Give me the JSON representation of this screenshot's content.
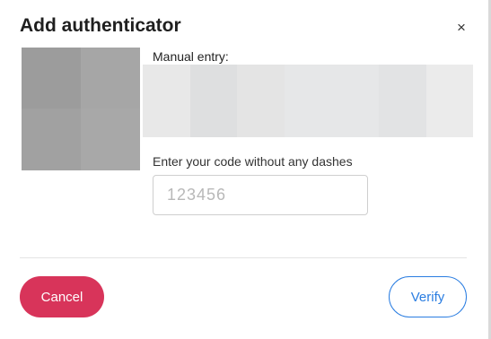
{
  "dialog": {
    "title": "Add authenticator",
    "close_icon": "close-icon",
    "close_glyph": "×"
  },
  "qr_code": {
    "description_icon": "qr-code-image",
    "blurred": true
  },
  "manual_entry": {
    "label": "Manual entry:",
    "secret_blurred": true
  },
  "code_field": {
    "label": "Enter your code without any dashes",
    "placeholder": "123456",
    "value": ""
  },
  "actions": {
    "cancel_label": "Cancel",
    "verify_label": "Verify"
  },
  "colors": {
    "cancel_bg": "#d8345a",
    "verify_accent": "#2a7de1"
  }
}
